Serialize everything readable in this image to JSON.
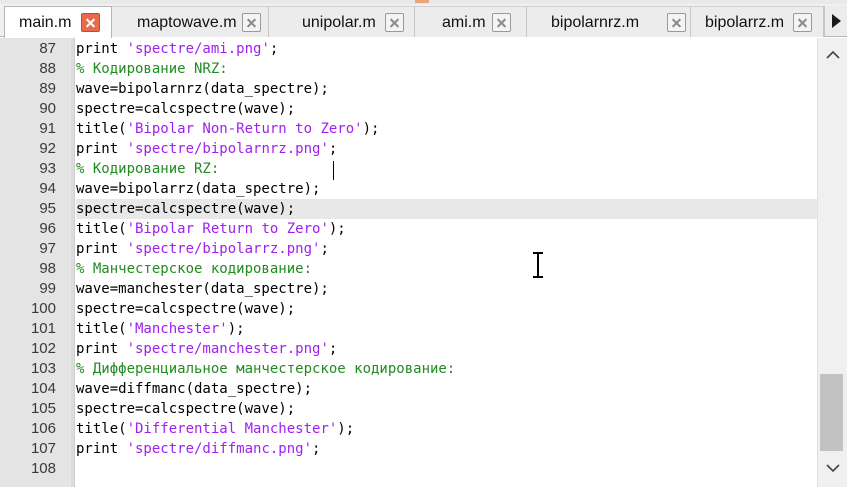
{
  "tabs": [
    {
      "label": "main.m",
      "active": true
    },
    {
      "label": "maptowave.m",
      "active": false
    },
    {
      "label": "unipolar.m",
      "active": false
    },
    {
      "label": "ami.m",
      "active": false
    },
    {
      "label": "bipolarnrz.m",
      "active": false
    },
    {
      "label": "bipolarrz.m",
      "active": false
    }
  ],
  "colors": {
    "keyword": "#000000",
    "string": "#a020f0",
    "comment": "#228b22",
    "close_active": "#e86a4d",
    "current_line": "#e8e8e8"
  },
  "editor": {
    "current_line": 95,
    "lines": [
      {
        "num": "87",
        "parts": [
          {
            "t": "print ",
            "k": "n"
          },
          {
            "t": "'spectre/ami.png'",
            "k": "s"
          },
          {
            "t": ";",
            "k": "n"
          }
        ]
      },
      {
        "num": "88",
        "parts": [
          {
            "t": "% Кодирование NRZ:",
            "k": "c"
          }
        ]
      },
      {
        "num": "89",
        "parts": [
          {
            "t": "wave=bipolarnrz(data_spectre);",
            "k": "n"
          }
        ]
      },
      {
        "num": "90",
        "parts": [
          {
            "t": "spectre=calcspectre(wave);",
            "k": "n"
          }
        ]
      },
      {
        "num": "91",
        "parts": [
          {
            "t": "title(",
            "k": "n"
          },
          {
            "t": "'Bipolar Non-Return to Zero'",
            "k": "s"
          },
          {
            "t": ");",
            "k": "n"
          }
        ]
      },
      {
        "num": "92",
        "parts": [
          {
            "t": "print ",
            "k": "n"
          },
          {
            "t": "'spectre/bipolarnrz.png'",
            "k": "s"
          },
          {
            "t": ";",
            "k": "n"
          }
        ]
      },
      {
        "num": "93",
        "parts": [
          {
            "t": "% Кодирование RZ:",
            "k": "c"
          }
        ]
      },
      {
        "num": "94",
        "parts": [
          {
            "t": "wave=bipolarrz(data_spectre);",
            "k": "n"
          }
        ]
      },
      {
        "num": "95",
        "parts": [
          {
            "t": "spectre=calcspectre(wave);",
            "k": "n"
          }
        ]
      },
      {
        "num": "96",
        "parts": [
          {
            "t": "title(",
            "k": "n"
          },
          {
            "t": "'Bipolar Return to Zero'",
            "k": "s"
          },
          {
            "t": ");",
            "k": "n"
          }
        ]
      },
      {
        "num": "97",
        "parts": [
          {
            "t": "print ",
            "k": "n"
          },
          {
            "t": "'spectre/bipolarrz.png'",
            "k": "s"
          },
          {
            "t": ";",
            "k": "n"
          }
        ]
      },
      {
        "num": "98",
        "parts": [
          {
            "t": "% Манчестерское кодирование:",
            "k": "c"
          }
        ]
      },
      {
        "num": "99",
        "parts": [
          {
            "t": "wave=manchester(data_spectre);",
            "k": "n"
          }
        ]
      },
      {
        "num": "100",
        "parts": [
          {
            "t": "spectre=calcspectre(wave);",
            "k": "n"
          }
        ]
      },
      {
        "num": "101",
        "parts": [
          {
            "t": "title(",
            "k": "n"
          },
          {
            "t": "'Manchester'",
            "k": "s"
          },
          {
            "t": ");",
            "k": "n"
          }
        ]
      },
      {
        "num": "102",
        "parts": [
          {
            "t": "print ",
            "k": "n"
          },
          {
            "t": "'spectre/manchester.png'",
            "k": "s"
          },
          {
            "t": ";",
            "k": "n"
          }
        ]
      },
      {
        "num": "103",
        "parts": [
          {
            "t": "% Дифференциальное манчестерское кодирование:",
            "k": "c"
          }
        ]
      },
      {
        "num": "104",
        "parts": [
          {
            "t": "wave=diffmanc(data_spectre);",
            "k": "n"
          }
        ]
      },
      {
        "num": "105",
        "parts": [
          {
            "t": "spectre=calcspectre(wave);",
            "k": "n"
          }
        ]
      },
      {
        "num": "106",
        "parts": [
          {
            "t": "title(",
            "k": "n"
          },
          {
            "t": "'Differential Manchester'",
            "k": "s"
          },
          {
            "t": ");",
            "k": "n"
          }
        ]
      },
      {
        "num": "107",
        "parts": [
          {
            "t": "print ",
            "k": "n"
          },
          {
            "t": "'spectre/diffmanc.png'",
            "k": "s"
          },
          {
            "t": ";",
            "k": "n"
          }
        ]
      },
      {
        "num": "108",
        "parts": []
      }
    ]
  },
  "icons": {
    "close": "close-icon",
    "tab_scroll": "chevron-right-icon",
    "scroll_up": "chevron-up-icon",
    "scroll_down": "chevron-down-icon",
    "cursor": "text-cursor-icon"
  }
}
